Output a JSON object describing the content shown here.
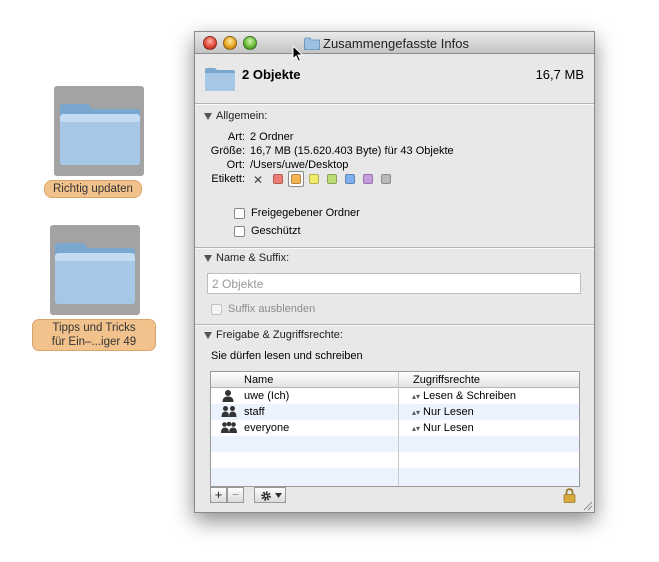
{
  "desktop": {
    "icons": [
      {
        "label": "Richtig updaten"
      },
      {
        "label_line1": "Tipps und Tricks",
        "label_line2": "für Ein–...iger 49"
      }
    ]
  },
  "window": {
    "title": "Zusammengefasste Infos",
    "header": {
      "name": "2 Objekte",
      "size": "16,7 MB"
    },
    "general": {
      "title": "Allgemein:",
      "art_label": "Art:",
      "art_value": "2 Ordner",
      "size_label": "Größe:",
      "size_value": "16,7 MB (15.620.403 Byte) für 43 Objekte",
      "location_label": "Ort:",
      "location_value": "/Users/uwe/Desktop",
      "label_label": "Etikett:",
      "label_clear": "✕",
      "label_colors": [
        "#ee7c74",
        "#f5b454",
        "#f1ea6a",
        "#b9dd72",
        "#7fb0f0",
        "#c89ce0",
        "#b9b9b9"
      ],
      "shared_folder": "Freigegebener Ordner",
      "protected": "Geschützt"
    },
    "name_suffix": {
      "title": "Name & Suffix:",
      "name_placeholder": "2 Objekte",
      "hide_suffix": "Suffix ausblenden"
    },
    "sharing": {
      "title": "Freigabe & Zugriffsrechte:",
      "info": "Sie dürfen lesen und schreiben",
      "col_name": "Name",
      "col_rights": "Zugriffsrechte",
      "rows": [
        {
          "name": "uwe (Ich)",
          "rights": "Lesen & Schreiben",
          "icon": "user-icon"
        },
        {
          "name": "staff",
          "rights": "Nur Lesen",
          "icon": "group-icon"
        },
        {
          "name": "everyone",
          "rights": "Nur Lesen",
          "icon": "group-icon"
        }
      ],
      "add": "+",
      "remove": "−"
    }
  }
}
